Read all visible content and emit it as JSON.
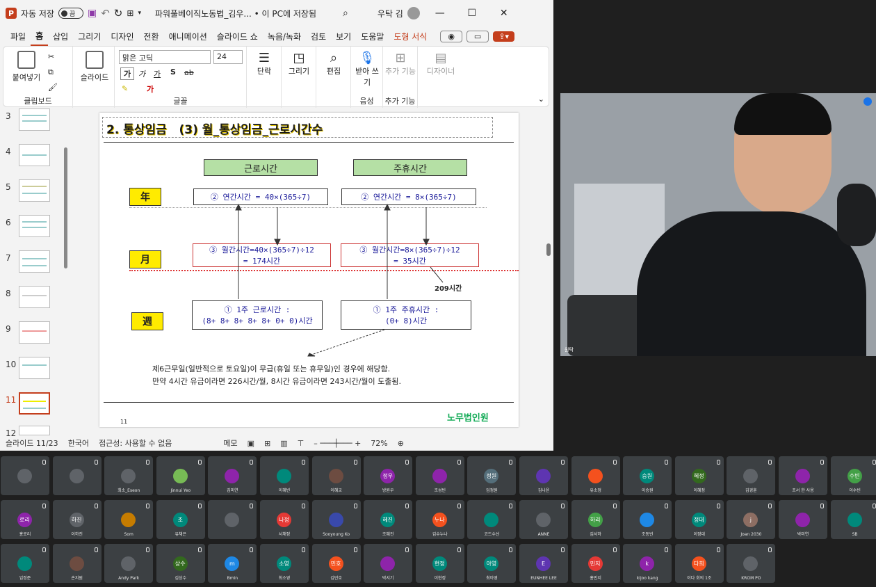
{
  "window": {
    "autosave_label": "자동 저장",
    "toggle_state": "끔",
    "doc_title": "파워풀베이직노동법_김우... • 이 PC에 저장됨",
    "user_name": "우탁 김"
  },
  "menu": [
    "파일",
    "홈",
    "삽입",
    "그리기",
    "디자인",
    "전환",
    "애니메이션",
    "슬라이드 쇼",
    "녹음/녹화",
    "검토",
    "보기",
    "도움말",
    "도형 서식"
  ],
  "ribbon": {
    "paste": "붙여넣기",
    "clipboard": "클립보드",
    "slide": "슬라이드",
    "font_name": "맑은 고딕",
    "font_size": "24",
    "font_group": "글꼴",
    "paragraph": "단락",
    "drawing": "그리기",
    "editing": "편집",
    "dictate": "받아 쓰기",
    "voice": "음성",
    "addins": "추가 기능",
    "addins_group": "추가 기능",
    "designer": "디자이너"
  },
  "thumbnails": [
    "3",
    "4",
    "5",
    "6",
    "7",
    "8",
    "9",
    "10",
    "11",
    "12"
  ],
  "slide": {
    "title": "2. 통상임금   (3) 월_통상임금_근로시간수",
    "col1": "근로시간",
    "col2": "주휴시간",
    "year": "年",
    "month": "月",
    "week": "週",
    "y1": "② 연간시간 = 40×(365÷7)",
    "y2": "② 연간시간 = 8×(365÷7)",
    "m1a": "③ 월간시간=40×(365÷7)÷12",
    "m1b": "= 174시간",
    "m2a": "③ 월간시간=8×(365÷7)÷12",
    "m2b": "= 35시간",
    "total": "209시간",
    "w1a": "① 1주 근로시간 :",
    "w1b": "(8+ 8+ 8+ 8+ 8+ 0+ 0)시간",
    "w2a": "① 1주 주휴시간 :",
    "w2b": "(0+ 8)시간",
    "note1": "제6근무일(일반적으로 토요일)이 무급(휴일 또는 휴무일)인 경우에 해당함.",
    "note2": "만약 4시간 유급이라면 226시간/월, 8시간 유급이라면 243시간/월이 도출됨.",
    "page": "11",
    "brand": "노무법인원"
  },
  "status": {
    "slide_no": "슬라이드 11/23",
    "lang": "한국어",
    "access": "접근성: 사용할 수 없음",
    "notes": "메모",
    "zoom": "72%"
  },
  "camera": {
    "name": "원탁"
  },
  "participants": [
    {
      "name": "",
      "color": "#5f6368"
    },
    {
      "name": "",
      "color": "#5f6368"
    },
    {
      "name": "최소_Eseon",
      "color": "#5f6368"
    },
    {
      "name": "Jinnui Yeo",
      "color": "#7b5"
    },
    {
      "name": "김미연",
      "color": "#8e24aa"
    },
    {
      "name": "이혜빈",
      "color": "#00897b"
    },
    {
      "name": "이혜교",
      "color": "#6d4c41"
    },
    {
      "name": "방원우",
      "color": "#8e24aa",
      "initials": "정우"
    },
    {
      "name": "조성빈",
      "color": "#8e24aa"
    },
    {
      "name": "임정원",
      "color": "#546e7a",
      "initials": "정원"
    },
    {
      "name": "김나윤",
      "color": "#5e35b1"
    },
    {
      "name": "유소정",
      "color": "#f4511e"
    },
    {
      "name": "이승원",
      "color": "#00897b",
      "initials": "승원"
    },
    {
      "name": "이혜정",
      "color": "#33691e",
      "initials": "혜정"
    },
    {
      "name": "김경훈",
      "color": "#5f6368"
    },
    {
      "name": "조서 한 사용",
      "color": "#8e24aa"
    },
    {
      "name": "이수빈",
      "color": "#43a047",
      "initials": "수빈"
    },
    {
      "name": "홍로리",
      "color": "#8e24aa",
      "initials": "로리"
    },
    {
      "name": "이하진",
      "color": "#5f6368",
      "initials": "하진"
    },
    {
      "name": "Som",
      "color": "#c67c00"
    },
    {
      "name": "유채은",
      "color": "#00897b",
      "initials": "조"
    },
    {
      "name": "",
      "color": "#5f6368"
    },
    {
      "name": "서채정",
      "color": "#e53935",
      "initials": "나정"
    },
    {
      "name": "Sooyoung Ko",
      "color": "#3949ab"
    },
    {
      "name": "조혜진",
      "color": "#00897b",
      "initials": "혜진"
    },
    {
      "name": "김수누나",
      "color": "#f4511e",
      "initials": "누나"
    },
    {
      "name": "코드수선",
      "color": "#00897b"
    },
    {
      "name": "ANNE",
      "color": "#5f6368"
    },
    {
      "name": "김서하",
      "color": "#43a047",
      "initials": "하리"
    },
    {
      "name": "조동빈",
      "color": "#1e88e5"
    },
    {
      "name": "이정대",
      "color": "#00897b",
      "initials": "정대"
    },
    {
      "name": "Joan 2030",
      "color": "#8d6e63",
      "initials": "j"
    },
    {
      "name": "박미연",
      "color": "#8e24aa"
    },
    {
      "name": "SB",
      "color": "#00897b"
    },
    {
      "name": "임정준",
      "color": "#00897b"
    },
    {
      "name": "손지원",
      "color": "#6d4c41"
    },
    {
      "name": "Andy Park",
      "color": "#5f6368"
    },
    {
      "name": "김상수",
      "color": "#33691e",
      "initials": "상수"
    },
    {
      "name": "Bmin",
      "color": "#1e88e5",
      "initials": "m"
    },
    {
      "name": "최소영",
      "color": "#00897b",
      "initials": "소영"
    },
    {
      "name": "김민호",
      "color": "#f4511e",
      "initials": "민호"
    },
    {
      "name": "박서기",
      "color": "#8e24aa"
    },
    {
      "name": "이현정",
      "color": "#00897b",
      "initials": "현정"
    },
    {
      "name": "최아영",
      "color": "#00897b",
      "initials": "아영"
    },
    {
      "name": "EUNHEE LEE",
      "color": "#5e35b1",
      "initials": "E"
    },
    {
      "name": "홍민지",
      "color": "#e53935",
      "initials": "민지"
    },
    {
      "name": "kijoo kang",
      "color": "#8e24aa",
      "initials": "k"
    },
    {
      "name": "이다 회의 1조",
      "color": "#f4511e",
      "initials": "다희"
    },
    {
      "name": "KROM PO",
      "color": "#5f6368"
    }
  ]
}
